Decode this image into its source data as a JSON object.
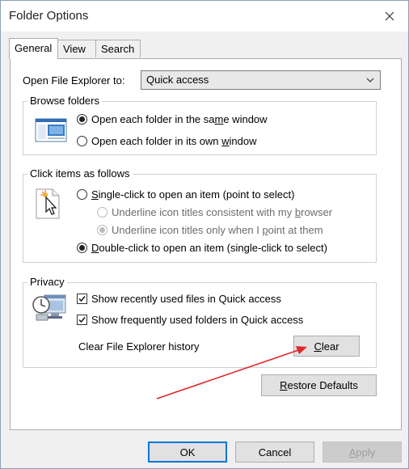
{
  "window": {
    "title": "Folder Options"
  },
  "tabs": [
    {
      "label": "General",
      "active": true
    },
    {
      "label": "View",
      "active": false
    },
    {
      "label": "Search",
      "active": false
    }
  ],
  "general": {
    "open_explorer_label": "Open File Explorer to:",
    "open_explorer_value": "Quick access",
    "browse": {
      "title": "Browse folders",
      "opt_same": {
        "pre": "Open each folder in the sa",
        "u": "m",
        "post": "e window",
        "checked": true
      },
      "opt_own": {
        "pre": "Open each folder in its own ",
        "u": "w",
        "post": "indow",
        "checked": false
      }
    },
    "click": {
      "title": "Click items as follows",
      "single": {
        "pre": "",
        "u": "S",
        "post": "ingle-click to open an item (point to select)",
        "checked": false
      },
      "ul_browser": {
        "pre": "Underline icon titles consistent with my ",
        "u": "b",
        "post": "rowser",
        "checked": false
      },
      "ul_point": {
        "pre": "Underline icon titles only when I ",
        "u": "p",
        "post": "oint at them",
        "checked": true
      },
      "double": {
        "pre": "",
        "u": "D",
        "post": "ouble-click to open an item (single-click to select)",
        "checked": true
      }
    },
    "privacy": {
      "title": "Privacy",
      "recent_files": {
        "label": "Show recently used files in Quick access",
        "checked": true
      },
      "frequent_folders": {
        "label": "Show frequently used folders in Quick access",
        "checked": true
      },
      "clear_history_label": "Clear File Explorer history",
      "clear_button": {
        "pre": "",
        "u": "C",
        "post": "lear"
      }
    },
    "restore_button": {
      "pre": "",
      "u": "R",
      "post": "estore Defaults"
    }
  },
  "footer": {
    "ok": "OK",
    "cancel": "Cancel",
    "apply": {
      "pre": "",
      "u": "A",
      "post": "pply"
    }
  },
  "colors": {
    "accent": "#0078d7",
    "annotation_arrow": "#e0262a"
  }
}
